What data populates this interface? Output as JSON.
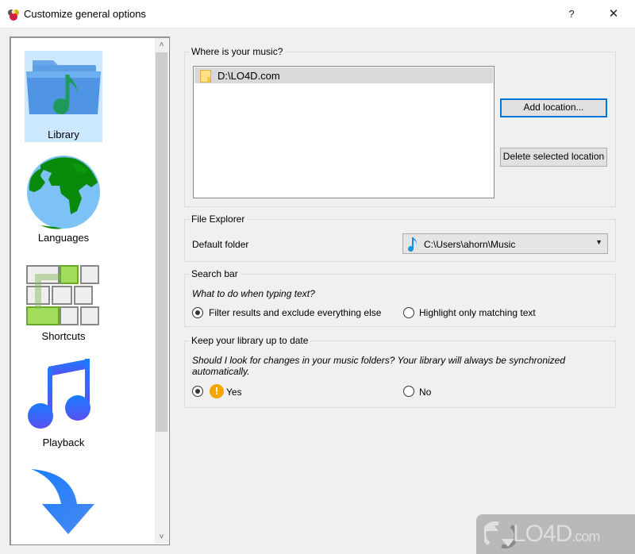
{
  "window": {
    "title": "Customize general options",
    "help_label": "?",
    "close_label": "✕"
  },
  "sidebar": {
    "items": [
      {
        "label": "Library",
        "icon": "music-folder-icon",
        "selected": true
      },
      {
        "label": "Languages",
        "icon": "globe-icon",
        "selected": false
      },
      {
        "label": "Shortcuts",
        "icon": "keyboard-shortcuts-icon",
        "selected": false
      },
      {
        "label": "Playback",
        "icon": "music-note-icon",
        "selected": false
      },
      {
        "label": "",
        "icon": "download-arrow-icon",
        "selected": false
      }
    ],
    "scroll_up": "˄",
    "scroll_down": "˅"
  },
  "music_locations": {
    "title": "Where is your music?",
    "items": [
      "D:\\LO4D.com"
    ],
    "add_button": "Add location...",
    "delete_button": "Delete selected location"
  },
  "file_explorer": {
    "title": "File Explorer",
    "default_folder_label": "Default folder",
    "default_folder_value": "C:\\Users\\ahorn\\Music"
  },
  "search_bar": {
    "title": "Search bar",
    "question": "What to do when typing text?",
    "options": [
      {
        "label": "Filter results and exclude everything else",
        "checked": true
      },
      {
        "label": "Highlight only matching text",
        "checked": false
      }
    ]
  },
  "library_sync": {
    "title": "Keep your library up to date",
    "question": "Should I look for changes in your music folders? Your library will always be synchronized automatically.",
    "options": [
      {
        "label": "Yes",
        "checked": true
      },
      {
        "label": "No",
        "checked": false
      }
    ]
  },
  "watermark": {
    "text": "LO4D",
    "suffix": ".com"
  },
  "colors": {
    "selection": "#cce8ff",
    "accent": "#0078d7",
    "warning": "#f5a500"
  }
}
